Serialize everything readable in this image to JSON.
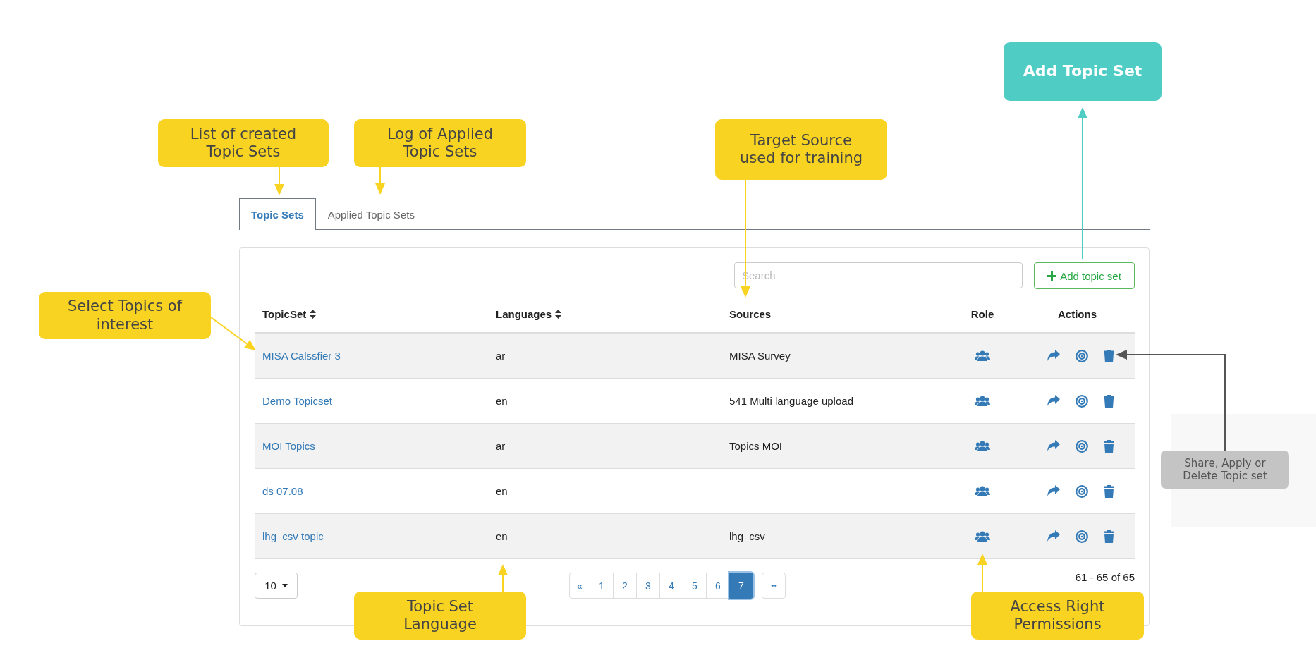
{
  "tabs": [
    {
      "label": "Topic Sets",
      "selected": true
    },
    {
      "label": "Applied Topic Sets",
      "selected": false
    }
  ],
  "search": {
    "placeholder": "Search"
  },
  "add_button": {
    "label": "Add topic set"
  },
  "table": {
    "columns": [
      {
        "label": "TopicSet",
        "sortable": true
      },
      {
        "label": "Languages",
        "sortable": true
      },
      {
        "label": "Sources",
        "sortable": false
      },
      {
        "label": "Role",
        "sortable": false
      },
      {
        "label": "Actions",
        "sortable": false
      }
    ],
    "rows": [
      {
        "topic_set": "MISA Calssfier 3",
        "language": "ar",
        "source": "MISA Survey"
      },
      {
        "topic_set": "Demo Topicset",
        "language": "en",
        "source": "541 Multi language upload"
      },
      {
        "topic_set": "MOI Topics",
        "language": "ar",
        "source": "Topics MOI"
      },
      {
        "topic_set": "ds 07.08",
        "language": "en"
      },
      {
        "topic_set": "lhg_csv topic",
        "language": "en",
        "source": "lhg_csv"
      }
    ]
  },
  "page_size": "10",
  "pagination": {
    "first": "«",
    "pages": [
      {
        "label": "1",
        "selected": false
      },
      {
        "label": "2",
        "selected": false
      },
      {
        "label": "3",
        "selected": false
      },
      {
        "label": "4",
        "selected": false
      },
      {
        "label": "5",
        "selected": false
      },
      {
        "label": "6",
        "selected": false
      },
      {
        "label": "7",
        "selected": true
      }
    ],
    "more": "•••"
  },
  "range": "61 - 65 of 65",
  "annotations": [
    {
      "kind": "primary",
      "text": "Add Topic Set"
    },
    {
      "kind": "note",
      "text": "List of created Topic Sets"
    },
    {
      "kind": "note",
      "text": "Log of Applied Topic Sets"
    },
    {
      "kind": "note",
      "text": "Target Source used for training"
    },
    {
      "kind": "note",
      "text": "Select Topics of interest"
    },
    {
      "kind": "muted",
      "text": "Share, Apply or Delete Topic set"
    },
    {
      "kind": "note",
      "text": "Topic Set Language"
    },
    {
      "kind": "note",
      "text": "Access Right Permissions"
    }
  ]
}
